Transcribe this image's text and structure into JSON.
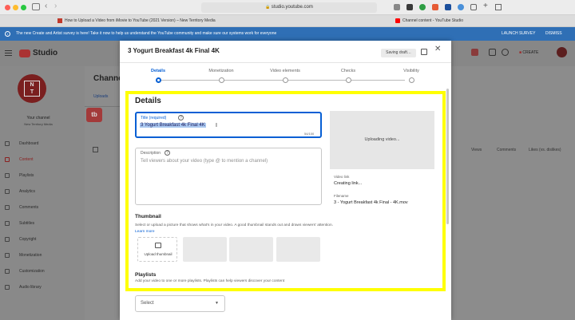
{
  "browser": {
    "url": "studio.youtube.com",
    "tabs": [
      "How to Upload a Video from iMovie to YouTube (2021 Version) – New Territory Media",
      "Channel content - YouTube Studio"
    ]
  },
  "banner": {
    "text": "The new Create and Artist survey is here! Take it now to help us understand the YouTube community and make sure our systems work for everyone",
    "launch": "LAUNCH SURVEY",
    "dismiss": "DISMISS"
  },
  "studio": {
    "logo": "Studio",
    "create": "CREATE",
    "channel_title": "Your channel",
    "channel_name": "New Territory Media",
    "page_title": "Channel content",
    "tab_uploads": "Uploads",
    "nav": [
      "Dashboard",
      "Content",
      "Playlists",
      "Analytics",
      "Comments",
      "Subtitles",
      "Copyright",
      "Monetization",
      "Customization",
      "Audio library"
    ],
    "table_cols": [
      "Views",
      "Comments",
      "Likes (vs. dislikes)"
    ],
    "badge": "tb"
  },
  "dialog": {
    "title": "3 Yogurt Breakfast 4k Final 4K",
    "saving": "Saving draft…",
    "steps": [
      "Details",
      "Monetization",
      "Video elements",
      "Checks",
      "Visibility"
    ],
    "section": "Details",
    "title_label": "Title (required)",
    "title_value": "3 Yogurt Breakfast 4k Final 4K",
    "title_count": "54/100",
    "desc_label": "Description",
    "desc_placeholder": "Tell viewers about your video (type @ to mention a channel)",
    "uploading": "Uploading video...",
    "video_link_label": "Video link",
    "video_link_value": "Creating link...",
    "filename_label": "Filename",
    "filename_value": "3 - Yogurt Breakfast 4k Final - 4K.mov",
    "thumb_title": "Thumbnail",
    "thumb_desc": "Select or upload a picture that shows what's in your video. A good thumbnail stands out and draws viewers' attention.",
    "learn_more": "Learn more",
    "upload_thumb": "Upload thumbnail",
    "playlists_title": "Playlists",
    "playlists_desc": "Add your video to one or more playlists. Playlists can help viewers discover your content",
    "select": "Select"
  },
  "colors": {
    "highlight": "#ffff00",
    "youtube_red": "#ff0000",
    "accent": "#065fd4"
  }
}
